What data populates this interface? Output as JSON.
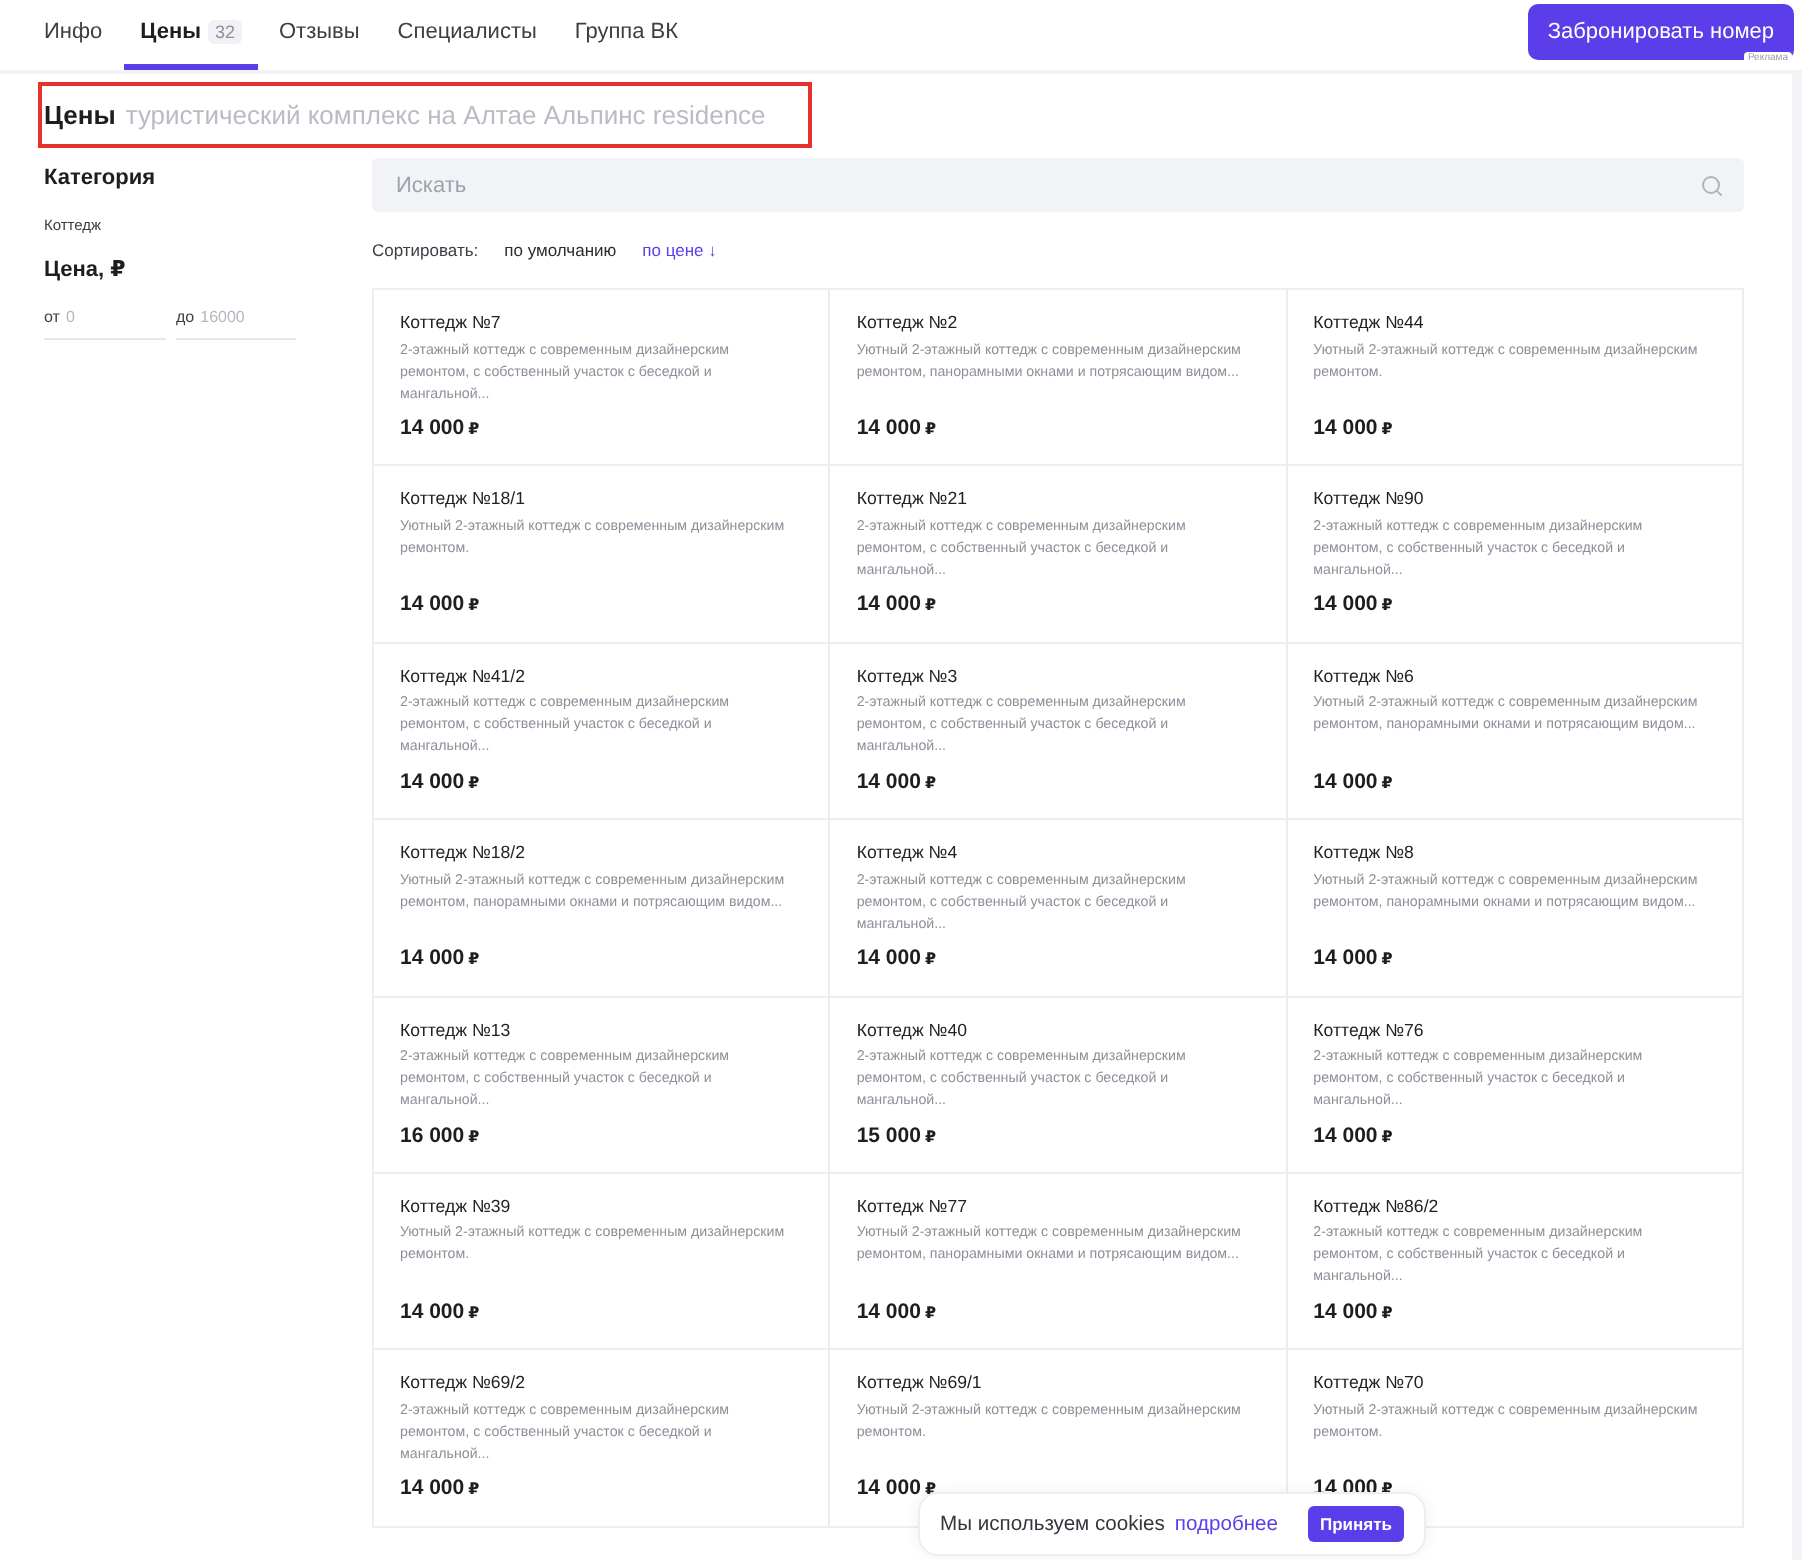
{
  "nav": {
    "tabs": [
      {
        "label": "Инфо",
        "selected": false
      },
      {
        "label": "Цены",
        "count": "32",
        "selected": true
      },
      {
        "label": "Отзывы",
        "selected": false
      },
      {
        "label": "Специалисты",
        "selected": false
      },
      {
        "label": "Группа ВК",
        "selected": false
      }
    ],
    "book_button": "Забронировать номер",
    "ad_label": "Реклама"
  },
  "heading": {
    "title": "Цены",
    "subtitle": "туристический комплекс на Алтае Альпинс residence",
    "highlighted": true
  },
  "filters": {
    "category": {
      "title": "Категория",
      "value": "Коттедж"
    },
    "price": {
      "title": "Цена, ₽",
      "from": {
        "prefix": "от",
        "placeholder": "0"
      },
      "to": {
        "prefix": "до",
        "placeholder": "16000"
      }
    }
  },
  "search": {
    "placeholder": "Искать"
  },
  "sort": {
    "label": "Сортировать:",
    "options": [
      {
        "label": "по умолчанию",
        "selected": false
      },
      {
        "label": "по цене ↓",
        "selected": true
      }
    ]
  },
  "cards": [
    {
      "title": "Коттедж №7",
      "description": "2-этажный коттедж с современным дизайнерским ремонтом, с собственный участок с беседкой и мангальной...",
      "price": "14 000",
      "currency": "₽"
    },
    {
      "title": "Коттедж №2",
      "description": "Уютный 2-этажный коттедж с современным дизайнерским ремонтом, панорамными окнами и потрясающим видом...",
      "price": "14 000",
      "currency": "₽"
    },
    {
      "title": "Коттедж №44",
      "description": "Уютный 2-этажный коттедж с современным дизайнерским ремонтом.",
      "price": "14 000",
      "currency": "₽"
    },
    {
      "title": "Коттедж №18/1",
      "description": "Уютный 2-этажный коттедж с современным дизайнерским ремонтом.",
      "price": "14 000",
      "currency": "₽"
    },
    {
      "title": "Коттедж №21",
      "description": "2-этажный коттедж с современным дизайнерским ремонтом, с собственный участок с беседкой и мангальной...",
      "price": "14 000",
      "currency": "₽"
    },
    {
      "title": "Коттедж №90",
      "description": "2-этажный коттедж с современным дизайнерским ремонтом, с собственный участок с беседкой и мангальной...",
      "price": "14 000",
      "currency": "₽"
    },
    {
      "title": "Коттедж №41/2",
      "description": "2-этажный коттедж с современным дизайнерским ремонтом, с собственный участок с беседкой и мангальной...",
      "price": "14 000",
      "currency": "₽"
    },
    {
      "title": "Коттедж №3",
      "description": "2-этажный коттедж с современным дизайнерским ремонтом, с собственный участок с беседкой и мангальной...",
      "price": "14 000",
      "currency": "₽"
    },
    {
      "title": "Коттедж №6",
      "description": "Уютный 2-этажный коттедж с современным дизайнерским ремонтом, панорамными окнами и потрясающим видом...",
      "price": "14 000",
      "currency": "₽"
    },
    {
      "title": "Коттедж №18/2",
      "description": "Уютный 2-этажный коттедж с современным дизайнерским ремонтом, панорамными окнами и потрясающим видом...",
      "price": "14 000",
      "currency": "₽"
    },
    {
      "title": "Коттедж №4",
      "description": "2-этажный коттедж с современным дизайнерским ремонтом, с собственный участок с беседкой и мангальной...",
      "price": "14 000",
      "currency": "₽"
    },
    {
      "title": "Коттедж №8",
      "description": "Уютный 2-этажный коттедж с современным дизайнерским ремонтом, панорамными окнами и потрясающим видом...",
      "price": "14 000",
      "currency": "₽"
    },
    {
      "title": "Коттедж №13",
      "description": "2-этажный коттедж с современным дизайнерским ремонтом, с собственный участок с беседкой и мангальной...",
      "price": "16 000",
      "currency": "₽"
    },
    {
      "title": "Коттедж №40",
      "description": "2-этажный коттедж с современным дизайнерским ремонтом, с собственный участок с беседкой и мангальной...",
      "price": "15 000",
      "currency": "₽"
    },
    {
      "title": "Коттедж №76",
      "description": "2-этажный коттедж с современным дизайнерским ремонтом, с собственный участок с беседкой и мангальной...",
      "price": "14 000",
      "currency": "₽"
    },
    {
      "title": "Коттедж №39",
      "description": "Уютный 2-этажный коттедж с современным дизайнерским ремонтом.",
      "price": "14 000",
      "currency": "₽"
    },
    {
      "title": "Коттедж №77",
      "description": "Уютный 2-этажный коттедж с современным дизайнерским ремонтом, панорамными окнами и потрясающим видом...",
      "price": "14 000",
      "currency": "₽"
    },
    {
      "title": "Коттедж №86/2",
      "description": "2-этажный коттедж с современным дизайнерским ремонтом, с собственный участок с беседкой и мангальной...",
      "price": "14 000",
      "currency": "₽"
    },
    {
      "title": "Коттедж №69/2",
      "description": "2-этажный коттедж с современным дизайнерским ремонтом, с собственный участок с беседкой и мангальной...",
      "price": "14 000",
      "currency": "₽"
    },
    {
      "title": "Коттедж №69/1",
      "description": "Уютный 2-этажный коттедж с современным дизайнерским ремонтом.",
      "price": "14 000",
      "currency": "₽"
    },
    {
      "title": "Коттедж №70",
      "description": "Уютный 2-этажный коттедж с современным дизайнерским ремонтом.",
      "price": "14 000",
      "currency": "₽"
    }
  ],
  "cookie_banner": {
    "text": "Мы используем cookies",
    "link": "подробнее",
    "button": "Принять"
  }
}
